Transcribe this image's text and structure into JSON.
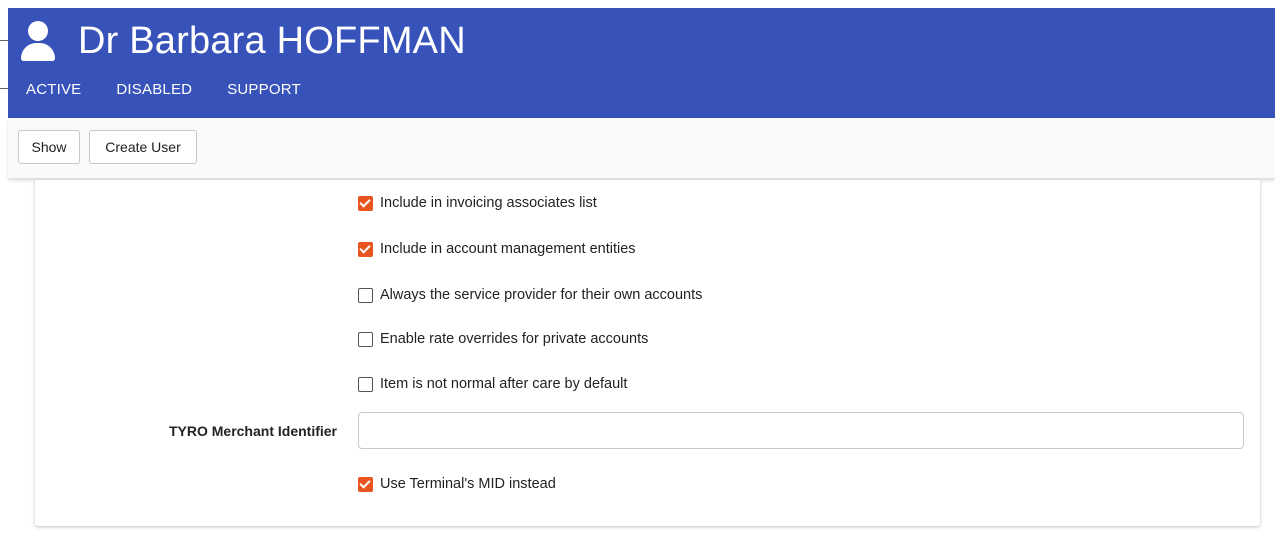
{
  "header": {
    "title": "Dr Barbara HOFFMAN",
    "tabs": [
      {
        "label": "ACTIVE"
      },
      {
        "label": "DISABLED"
      },
      {
        "label": "SUPPORT"
      }
    ],
    "color": "#3752b8",
    "icon": "user-icon"
  },
  "toolbar": {
    "show_label": "Show",
    "create_user_label": "Create User"
  },
  "form": {
    "checkboxes": [
      {
        "label": "Include in invoicing associates list",
        "checked": true
      },
      {
        "label": "Include in account management entities",
        "checked": true
      },
      {
        "label": "Always the service provider for their own accounts",
        "checked": false
      },
      {
        "label": "Enable rate overrides for private accounts",
        "checked": false
      },
      {
        "label": "Item is not normal after care by default",
        "checked": false
      }
    ],
    "tyro_label": "TYRO Merchant Identifier",
    "tyro_value": "",
    "terminal_mid": {
      "label": "Use Terminal's MID instead",
      "checked": true
    },
    "accent_color": "#e8541e"
  }
}
